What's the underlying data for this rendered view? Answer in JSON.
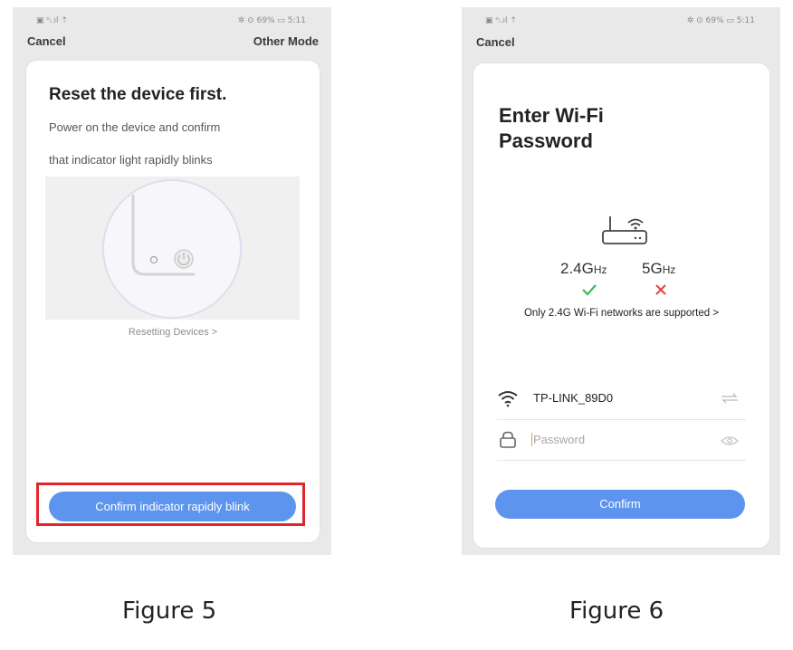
{
  "figure5": {
    "status_left": "▣ ᵒᵢ.ıl ⇡",
    "status_right": "✲ ⊙ 69% ▭ 5:11",
    "cancel_label": "Cancel",
    "other_mode_label": "Other Mode",
    "title": "Reset the device first.",
    "description_line1": "Power on the device and confirm",
    "description_line2": "that indicator light rapidly blinks",
    "resetting_link": "Resetting Devices >",
    "confirm_button": "Confirm indicator rapidly blink",
    "caption": "Figure 5",
    "highlight_color": "#e0262b",
    "accent_color": "#5d95ee"
  },
  "figure6": {
    "status_left": "▣ ᵒᵢ.ıl ⇡",
    "status_right": "✲ ⊙ 69% ▭ 5:11",
    "cancel_label": "Cancel",
    "title_line1": "Enter Wi-Fi",
    "title_line2": "Password",
    "band_24": "2.4G",
    "band_24_unit": "Hz",
    "band_5": "5G",
    "band_5_unit": "Hz",
    "supported_note": "Only 2.4G Wi-Fi networks are supported >",
    "ssid_value": "TP-LINK_89D0",
    "password_placeholder": "Password",
    "confirm_button": "Confirm",
    "caption": "Figure 6",
    "check_color": "#3dba4e",
    "cross_color": "#e04a4a"
  }
}
